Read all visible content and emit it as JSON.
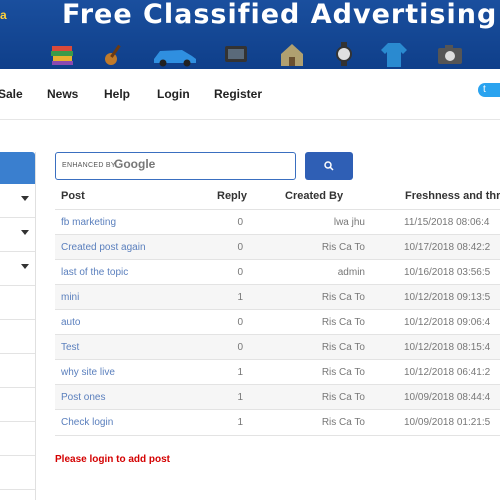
{
  "banner": {
    "title": "Free Classified Advertising",
    "logo_fragment": "a",
    "icons": [
      "books-icon",
      "guitar-icon",
      "car-icon",
      "tv-icon",
      "house-icon",
      "watch-icon",
      "sweater-icon",
      "camera-icon"
    ]
  },
  "nav": {
    "items": [
      "Sale",
      "News",
      "Help",
      "Login",
      "Register"
    ],
    "twitter_label": "t"
  },
  "search": {
    "enhanced_by": "ENHANCED BY",
    "google": "Google",
    "placeholder": ""
  },
  "table": {
    "headers": [
      "Post",
      "Reply",
      "Created By",
      "Freshness and threa"
    ],
    "rows": [
      {
        "post": "fb marketing",
        "reply": "0",
        "by": "lwa jhu",
        "fresh": "11/15/2018 08:06:4"
      },
      {
        "post": "Created post again",
        "reply": "0",
        "by": "Ris Ca To",
        "fresh": "10/17/2018 08:42:2"
      },
      {
        "post": "last of the topic",
        "reply": "0",
        "by": "admin",
        "fresh": "10/16/2018 03:56:5"
      },
      {
        "post": "mini",
        "reply": "1",
        "by": "Ris Ca To",
        "fresh": "10/12/2018 09:13:5"
      },
      {
        "post": "auto",
        "reply": "0",
        "by": "Ris Ca To",
        "fresh": "10/12/2018 09:06:4"
      },
      {
        "post": "Test",
        "reply": "0",
        "by": "Ris Ca To",
        "fresh": "10/12/2018 08:15:4"
      },
      {
        "post": "why site live",
        "reply": "1",
        "by": "Ris Ca To",
        "fresh": "10/12/2018 06:41:2"
      },
      {
        "post": "Post ones",
        "reply": "1",
        "by": "Ris Ca To",
        "fresh": "10/09/2018 08:44:4"
      },
      {
        "post": "Check login",
        "reply": "1",
        "by": "Ris Ca To",
        "fresh": "10/09/2018 01:21:5"
      }
    ]
  },
  "login_message": "Please login to add post",
  "colors": {
    "banner_bg": "#1a4f9e",
    "search_button": "#2f5fb5",
    "sidebar_head": "#3a7fcf",
    "link": "#5a7fbd",
    "error": "#d40000"
  }
}
